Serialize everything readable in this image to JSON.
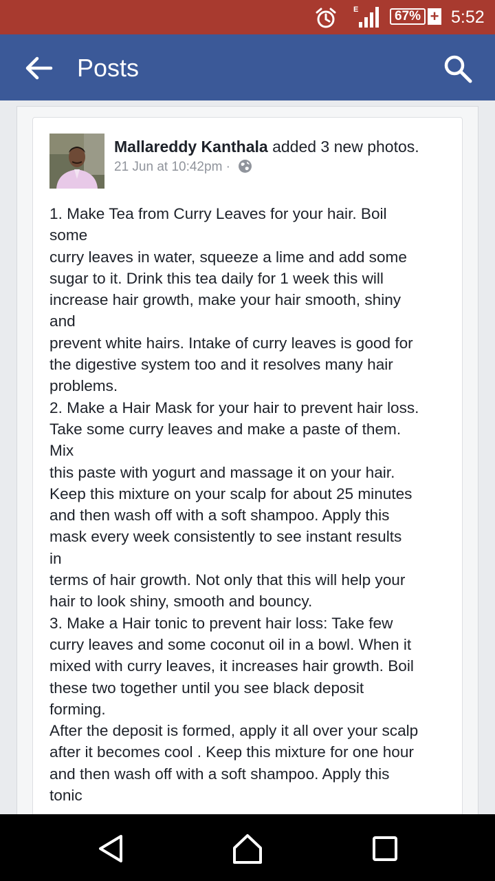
{
  "status_bar": {
    "network_label": "E",
    "battery": "67%",
    "battery_plus": "+",
    "time": "5:52",
    "icons": [
      "alarm-clock-icon",
      "signal-icon",
      "battery-icon"
    ]
  },
  "app_bar": {
    "title": "Posts",
    "back_icon": "arrow-left-icon",
    "search_icon": "search-icon",
    "background": "#3b5998"
  },
  "post": {
    "author": "Mallareddy Kanthala",
    "action": " added 3 new photos.",
    "timestamp": "21 Jun at 10:42pm",
    "separator": "·",
    "privacy_icon": "globe-icon",
    "lines": [
      "1. Make Tea from Curry Leaves for your hair. Boil",
      "some",
      "curry leaves in water, squeeze a lime and add some",
      "sugar to it. Drink this tea daily for 1 week this will",
      "increase hair growth, make your hair smooth, shiny",
      "and",
      "prevent white hairs. Intake of curry leaves is good for",
      "the digestive system too and it resolves many hair",
      "problems.",
      "2. Make a Hair Mask for your hair to prevent hair loss.",
      "Take some curry leaves and make a paste of them.",
      "Mix",
      "this paste with yogurt and massage it on your hair.",
      "Keep this mixture on your scalp for about 25 minutes",
      "and then wash off with a soft shampoo. Apply this",
      "mask every week consistently to see instant results",
      "in",
      "terms of hair growth. Not only that this will help your",
      "hair to look shiny, smooth and bouncy.",
      "3. Make a Hair tonic to prevent hair loss: Take few",
      "curry leaves and some coconut oil in a bowl. When it",
      "mixed with curry leaves, it increases hair growth. Boil",
      "these two together until you see black deposit",
      "forming.",
      "After the deposit is formed, apply it all over your scalp",
      "after it becomes cool . Keep this mixture for one hour",
      "and then wash off with a soft shampoo. Apply this",
      "tonic"
    ]
  },
  "nav_bar": {
    "icons": [
      "nav-back-icon",
      "nav-home-icon",
      "nav-recents-icon"
    ]
  },
  "colors": {
    "status_bar": "#a83a2f",
    "app_bar": "#3b5998",
    "text": "#1d2129",
    "meta": "#90949c"
  }
}
